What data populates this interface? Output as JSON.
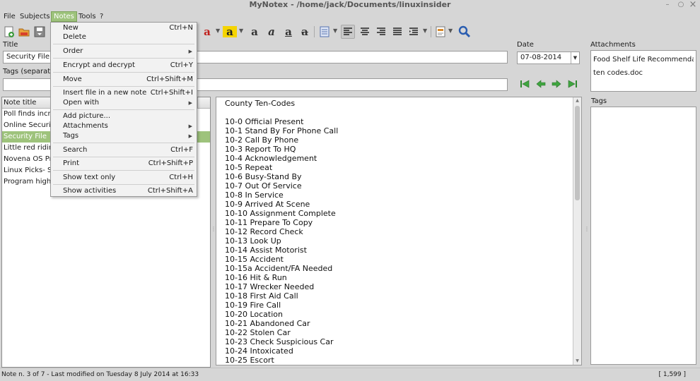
{
  "window": {
    "title": "MyNotex - /home/jack/Documents/linuxinsider",
    "minimize": "–",
    "maximize": "○",
    "close": "×"
  },
  "menubar": {
    "file": "File",
    "subjects": "Subjects",
    "notes": "Notes",
    "tools": "Tools",
    "help": "?"
  },
  "notes_menu": {
    "new": "New",
    "new_sc": "Ctrl+N",
    "delete": "Delete",
    "order": "Order",
    "encrypt": "Encrypt and decrypt",
    "encrypt_sc": "Ctrl+Y",
    "move": "Move",
    "move_sc": "Ctrl+Shift+M",
    "insert_file": "Insert file in a new note",
    "insert_file_sc": "Ctrl+Shift+I",
    "open_with": "Open with",
    "add_picture": "Add picture...",
    "attachments": "Attachments",
    "tags": "Tags",
    "search": "Search",
    "search_sc": "Ctrl+F",
    "print": "Print",
    "print_sc": "Ctrl+Shift+P",
    "show_text": "Show text only",
    "show_text_sc": "Ctrl+H",
    "show_activities": "Show activities",
    "show_activities_sc": "Ctrl+Shift+A"
  },
  "fields": {
    "title_label": "Title",
    "title_value": "Security File",
    "tags_label": "Tags (separated",
    "date_label": "Date",
    "date_value": "07-08-2014",
    "attachments_label": "Attachments",
    "tags_panel_label": "Tags"
  },
  "attachments": [
    "Food Shelf Life Recommendation",
    "ten codes.doc"
  ],
  "notes_list": {
    "header": "Note title",
    "rows": [
      "Poll finds increa",
      "Online Security",
      "Security File",
      "Little red riding",
      "Novena OS Proj",
      "Linux Picks- Sky",
      "Program highlig"
    ]
  },
  "editor": {
    "lines": [
      "County Ten-Codes",
      "10-0 Official Present",
      "10-1 Stand By For Phone Call",
      "10-2 Call By Phone",
      "10-3 Report To HQ",
      "10-4 Acknowledgement",
      "10-5 Repeat",
      "10-6 Busy-Stand By",
      "10-7 Out Of Service",
      "10-8 In Service",
      "10-9 Arrived At Scene",
      "10-10 Assignment Complete",
      "10-11 Prepare To Copy",
      "10-12 Record Check",
      "10-13 Look Up",
      "10-14 Assist Motorist",
      "10-15 Accident",
      "10-15a Accident/FA Needed",
      "10-16 Hit & Run",
      "10-17 Wrecker Needed",
      "10-18 First Aid Call",
      "10-19 Fire Call",
      "10-20 Location",
      "10-21 Abandoned Car",
      "10-22 Stolen Car",
      "10-23 Check Suspicious Car",
      "10-24 Intoxicated",
      "10-25 Escort"
    ]
  },
  "statusbar": {
    "text": "Note n. 3 of 7 - Last modified on Tuesday 8 July 2014 at 16:33",
    "position": "[ 1,599 ]"
  },
  "toolbar": {
    "text_color_letter": "a",
    "highlight_letter": "a",
    "bold_letter": "a",
    "italic_letter": "a",
    "underline_letter": "a",
    "strike_letter": "a"
  },
  "colors": {
    "accent": "#9ec37c",
    "nav_green": "#2e8a2e",
    "search_blue": "#2a5db0"
  }
}
